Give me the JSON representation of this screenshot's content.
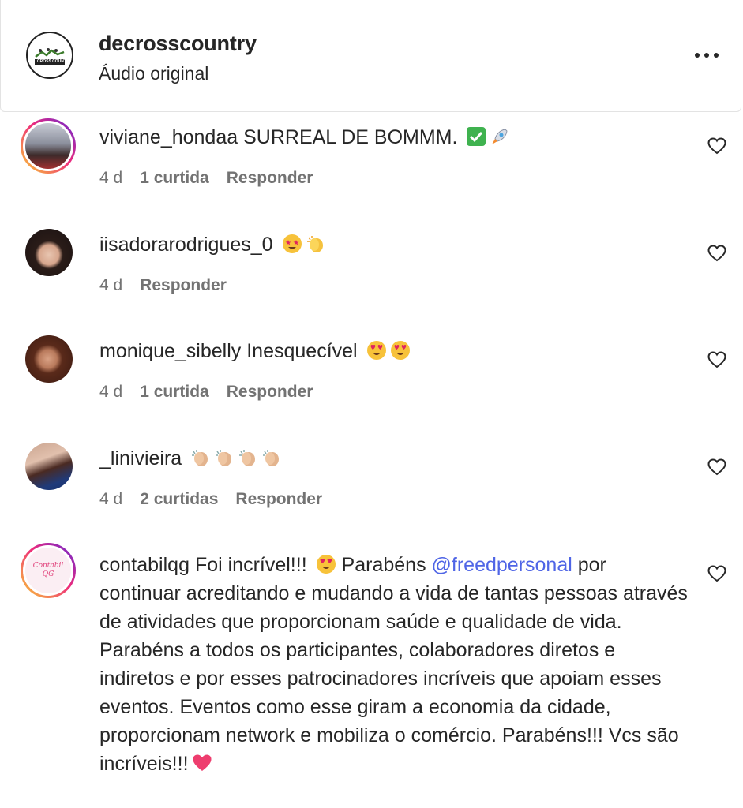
{
  "header": {
    "username": "decrosscountry",
    "subtitle": "Áudio original",
    "logo_text": "CROSS COUNTRY"
  },
  "comments": [
    {
      "username": "viviane_hondaa",
      "text": "SURREAL DE BOMMM.",
      "emojis": [
        "check-mark-emoji",
        "rocket-emoji"
      ],
      "time": "4 d",
      "likes": "1 curtida",
      "reply": "Responder"
    },
    {
      "username": "iisadorarodrigues_0",
      "text": "",
      "emojis": [
        "star-struck-emoji",
        "clapping-hands-emoji"
      ],
      "time": "4 d",
      "likes": "",
      "reply": "Responder"
    },
    {
      "username": "monique_sibelly",
      "text": "Inesquecível",
      "emojis": [
        "heart-eyes-emoji",
        "heart-eyes-emoji"
      ],
      "time": "4 d",
      "likes": "1 curtida",
      "reply": "Responder"
    },
    {
      "username": "_linivieira",
      "text": "",
      "emojis": [
        "clapping-hands-emoji",
        "clapping-hands-emoji",
        "clapping-hands-emoji",
        "clapping-hands-emoji"
      ],
      "time": "4 d",
      "likes": "2 curtidas",
      "reply": "Responder"
    },
    {
      "username": "contabilqg",
      "text_before_emoji": "Foi incrível!!!",
      "text_after_emoji": "Parabéns",
      "mention": "@freedpersonal",
      "text_after_mention": "por continuar acreditando e mudando a vida de tantas pessoas através de atividades que proporcionam saúde e qualidade de vida. Parabéns a todos os participantes, colaboradores diretos e indiretos e por esses patrocinadores incríveis que apoiam esses eventos. Eventos como esse giram a economia da cidade, proporcionam network e mobiliza o comércio. Parabéns!!! Vcs são incríveis!!!",
      "emojis": [
        "heart-eyes-emoji",
        "pink-heart-emoji"
      ],
      "avatar_text": "Contabil QG"
    }
  ],
  "colors": {
    "text": "#262626",
    "meta": "#737373",
    "mention": "#4f65e6",
    "story_ring_start": "#f9ce34",
    "story_ring_end": "#6228d7"
  }
}
